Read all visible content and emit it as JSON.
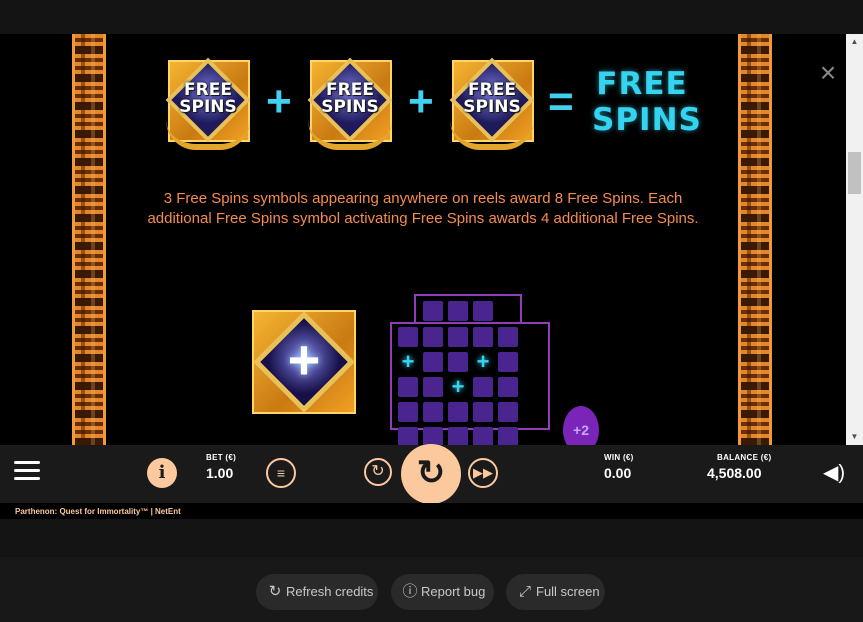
{
  "paytable": {
    "symbol_text": "FREE\nSPINS",
    "plus_sign": "+",
    "equals_sign": "=",
    "result_text": "FREE\nSPINS",
    "description": "3 Free Spins symbols appearing anywhere on reels award 8 Free Spins. Each additional Free Spins symbol activating Free Spins awards 4 additional Free Spins.",
    "bonus_symbol_glyph": "+",
    "grid_plus_glyph": "+",
    "badge_text": "+2",
    "close_glyph": "×"
  },
  "controls": {
    "info_glyph": "i",
    "bet_label": "BET (€)",
    "bet_value": "1.00",
    "win_label": "WIN (€)",
    "win_value": "0.00",
    "balance_label": "BALANCE (€)",
    "balance_value": "4,508.00"
  },
  "footer": {
    "game_title": "Parthenon: Quest for Immortality™  |  NetEnt"
  },
  "bottom_buttons": {
    "refresh": "Refresh credits",
    "report": "Report bug",
    "fullscreen": "Full screen"
  },
  "icons": {
    "menu": "hamburger-menu-icon",
    "info": "info-icon",
    "coins": "coin-stack-icon",
    "autoplay": "autoplay-icon",
    "spin": "spin-icon",
    "turbo": "fast-forward-icon",
    "sound": "speaker-icon",
    "refresh": "refresh-icon",
    "report": "alert-circle-icon",
    "fullscreen": "expand-icon"
  },
  "colors": {
    "accent": "#fcc89d",
    "description_text": "#f68b50",
    "free_spins_cyan": "#34d3f0",
    "grid_purple": "#4a2590"
  }
}
